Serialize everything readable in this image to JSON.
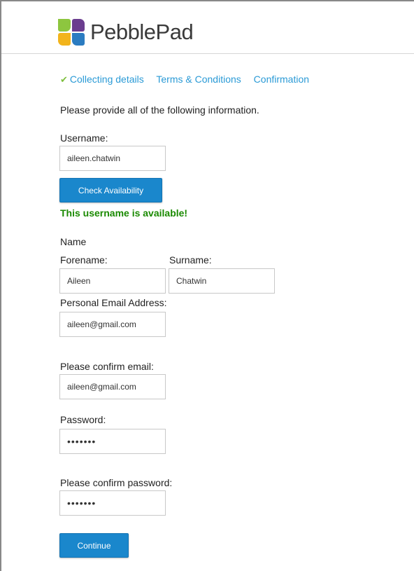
{
  "brand": {
    "name": "PebblePad",
    "colors": {
      "green": "#8dc63f",
      "purple": "#6b3d8f",
      "yellow": "#f2b41c",
      "blue": "#2b7cc1"
    }
  },
  "steps": [
    {
      "label": "Collecting details",
      "state": "complete"
    },
    {
      "label": "Terms & Conditions",
      "state": "pending"
    },
    {
      "label": "Confirmation",
      "state": "pending"
    }
  ],
  "intro": "Please provide all of the following information.",
  "username": {
    "label": "Username:",
    "value": "aileen.chatwin",
    "check_button": "Check Availability",
    "availability_message": "This username is available!"
  },
  "name": {
    "heading": "Name",
    "forename_label": "Forename:",
    "forename_value": "Aileen",
    "surname_label": "Surname:",
    "surname_value": "Chatwin"
  },
  "email": {
    "label": "Personal Email Address:",
    "value": "aileen@gmail.com",
    "confirm_label": "Please confirm email:",
    "confirm_value": "aileen@gmail.com"
  },
  "password": {
    "label": "Password:",
    "value": "•••••••",
    "confirm_label": "Please confirm password:",
    "confirm_value": "•••••••"
  },
  "continue_button": "Continue",
  "colors": {
    "accent": "#1a87cc",
    "link": "#2a9ad6",
    "success": "#1a8a00",
    "check": "#7dbf3c"
  }
}
